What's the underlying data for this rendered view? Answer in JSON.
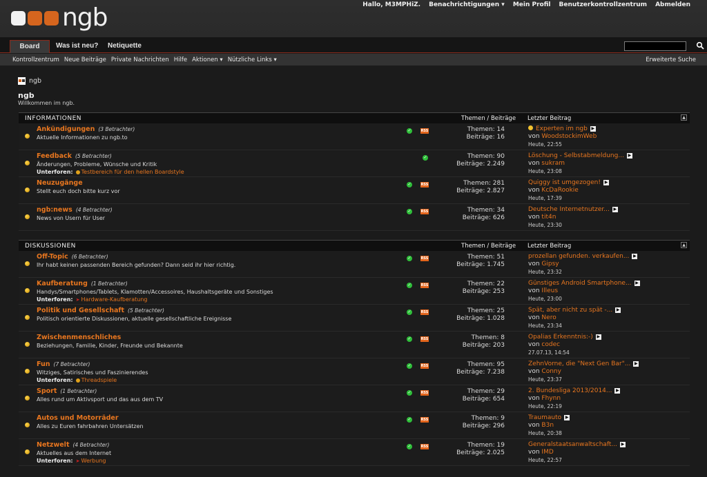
{
  "logo": {
    "text": "ngb"
  },
  "topnav": {
    "greeting": "Hallo, M3MPHiZ.",
    "notifications": "Benachrichtigungen",
    "profile": "Mein Profil",
    "control_center": "Benutzerkontrollzentrum",
    "logout": "Abmelden"
  },
  "tabs": [
    "Board",
    "Was ist neu?",
    "Netiquette"
  ],
  "subnav": {
    "items": [
      "Kontrollzentrum",
      "Neue Beiträge",
      "Private Nachrichten",
      "Hilfe",
      "Aktionen",
      "Nützliche Links"
    ],
    "advanced_search": "Erweiterte Suche"
  },
  "breadcrumb": "ngb",
  "page": {
    "title": "ngb",
    "subtitle": "Willkommen im ngb."
  },
  "columns": {
    "threads_posts": "Themen / Beiträge",
    "last_post": "Letzter Beitrag"
  },
  "categories": [
    {
      "name": "INFORMATIONEN",
      "forums": [
        {
          "title": "Ankündigungen",
          "viewers": "(3 Betrachter)",
          "desc": "Aktuelle Informationen zu ngb.to",
          "threads": "Themen: 14",
          "posts": "Beiträge: 16",
          "last_title": "Experten im ngb",
          "last_by": "WoodstockimWeb",
          "last_time": "Heute, 22:55"
        },
        {
          "title": "Feedback",
          "viewers": "(5 Betrachter)",
          "desc": "Änderungen, Probleme, Wünsche und Kritik",
          "sub_label": "Unterforen:",
          "sub": "Testbereich für den hellen Boardstyle",
          "threads": "Themen: 90",
          "posts": "Beiträge: 2.249",
          "last_title": "Löschung - Selbstabmeldung...",
          "last_by": "sukram",
          "last_time": "Heute, 23:08"
        },
        {
          "title": "Neuzugänge",
          "viewers": "",
          "desc": "Stellt euch doch bitte kurz vor",
          "threads": "Themen: 281",
          "posts": "Beiträge: 2.827",
          "last_title": "Quiggy ist umgezogen!",
          "last_by": "KcDaRookie",
          "last_time": "Heute, 17:39"
        },
        {
          "title": "ngb:news",
          "viewers": "(4 Betrachter)",
          "desc": "News von Usern für User",
          "threads": "Themen: 34",
          "posts": "Beiträge: 626",
          "last_title": "Deutsche Internetnutzer...",
          "last_by": "tit4n",
          "last_time": "Heute, 23:30"
        }
      ]
    },
    {
      "name": "DISKUSSIONEN",
      "forums": [
        {
          "title": "Off-Topic",
          "viewers": "(6 Betrachter)",
          "desc": "Ihr habt keinen passenden Bereich gefunden? Dann seid ihr hier richtig.",
          "threads": "Themen: 51",
          "posts": "Beiträge: 1.745",
          "last_title": "prozellan gefunden. verkaufen...",
          "last_by": "Gipsy",
          "last_time": "Heute, 23:32"
        },
        {
          "title": "Kaufberatung",
          "viewers": "(1 Betrachter)",
          "desc": "Handys/Smartphones/Tablets, Klamotten/Accessoires, Haushaltsgeräte und Sonstiges",
          "sub_label": "Unterforen:",
          "sub": "Hardware-Kaufberatung",
          "threads": "Themen: 22",
          "posts": "Beiträge: 253",
          "last_title": "Günstiges Android Smartphone...",
          "last_by": "Illeus",
          "last_time": "Heute, 23:00"
        },
        {
          "title": "Politik und Gesellschaft",
          "viewers": "(5 Betrachter)",
          "desc": "Politisch orientierte Diskussionen, aktuelle gesellschaftliche Ereignisse",
          "threads": "Themen: 25",
          "posts": "Beiträge: 1.028",
          "last_title": "Spät, aber nicht zu spät -...",
          "last_by": "Nero",
          "last_time": "Heute, 23:34"
        },
        {
          "title": "Zwischenmenschliches",
          "viewers": "",
          "desc": "Beziehungen, Familie, Kinder, Freunde und Bekannte",
          "threads": "Themen: 8",
          "posts": "Beiträge: 203",
          "last_title": "Opalias Erkenntnis:-)",
          "last_by": "codec",
          "last_time": "27.07.13, 14:54"
        },
        {
          "title": "Fun",
          "viewers": "(7 Betrachter)",
          "desc": "Witziges, Satirisches und Faszinierendes",
          "sub_label": "Unterforen:",
          "sub": "Threadspiele",
          "threads": "Themen: 95",
          "posts": "Beiträge: 7.238",
          "last_title": "ZehnVorne, die \"Next Gen Bar\"...",
          "last_by": "Conny",
          "last_time": "Heute, 23:37"
        },
        {
          "title": "Sport",
          "viewers": "(1 Betrachter)",
          "desc": "Alles rund um Aktivsport und das aus dem TV",
          "threads": "Themen: 29",
          "posts": "Beiträge: 654",
          "last_title": "2. Bundesliga 2013/2014...",
          "last_by": "Fhynn",
          "last_time": "Heute, 22:19"
        },
        {
          "title": "Autos und Motorräder",
          "viewers": "",
          "desc": "Alles zu Euren fahrbahren Untersätzen",
          "threads": "Themen: 9",
          "posts": "Beiträge: 296",
          "last_title": "Traumauto",
          "last_by": "B3n",
          "last_time": "Heute, 20:38"
        },
        {
          "title": "Netzwelt",
          "viewers": "(4 Betrachter)",
          "desc": "Aktuelles aus dem Internet",
          "sub_label": "Unterforen:",
          "sub": "Werbung",
          "threads": "Themen: 19",
          "posts": "Beiträge: 2.025",
          "last_title": "Generalstaatsanwaltschaft...",
          "last_by": "IMD",
          "last_time": "Heute, 22:57"
        }
      ]
    }
  ],
  "labels": {
    "by": "von"
  }
}
